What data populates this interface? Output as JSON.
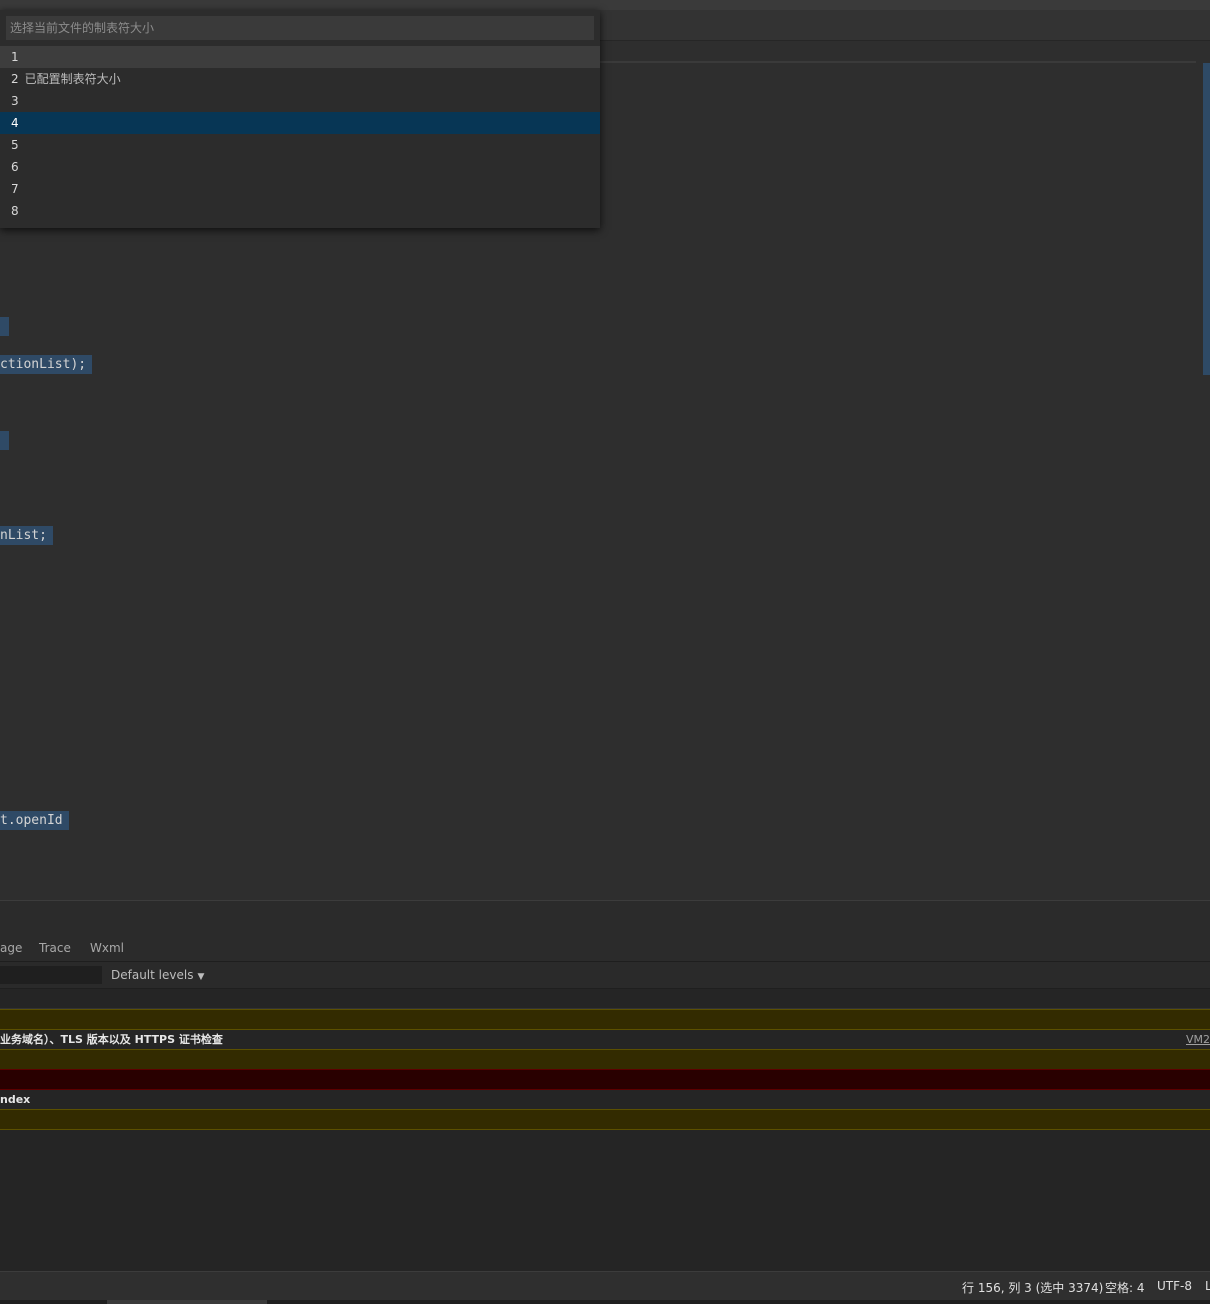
{
  "quick_pick": {
    "placeholder": "选择当前文件的制表符大小",
    "items": [
      {
        "label": "1",
        "description": ""
      },
      {
        "label": "2",
        "description": "已配置制表符大小"
      },
      {
        "label": "3",
        "description": ""
      },
      {
        "label": "4",
        "description": ""
      },
      {
        "label": "5",
        "description": ""
      },
      {
        "label": "6",
        "description": ""
      },
      {
        "label": "7",
        "description": ""
      },
      {
        "label": "8",
        "description": ""
      }
    ],
    "active_item": "4"
  },
  "editor": {
    "fragments": [
      "ctionList);",
      "nList;",
      "t.openId"
    ]
  },
  "panel": {
    "tabs": [
      "age",
      "Trace",
      "Wxml"
    ],
    "levels_label": "Default levels",
    "rows": [
      {
        "text": "业务域名）、TLS 版本以及 HTTPS 证书检查",
        "link": "VM2"
      },
      {
        "text": "ndex",
        "link": ""
      }
    ]
  },
  "status_bar": {
    "position": "行 156, 列 3 (选中 3374)",
    "indent": "空格: 4",
    "encoding": "UTF-8",
    "eol": "L"
  },
  "colors": {
    "active_item_bg": "#073655",
    "selection_bg": "#2f4a66",
    "warning_row_bg": "#332b00",
    "error_row_bg": "#290000"
  }
}
